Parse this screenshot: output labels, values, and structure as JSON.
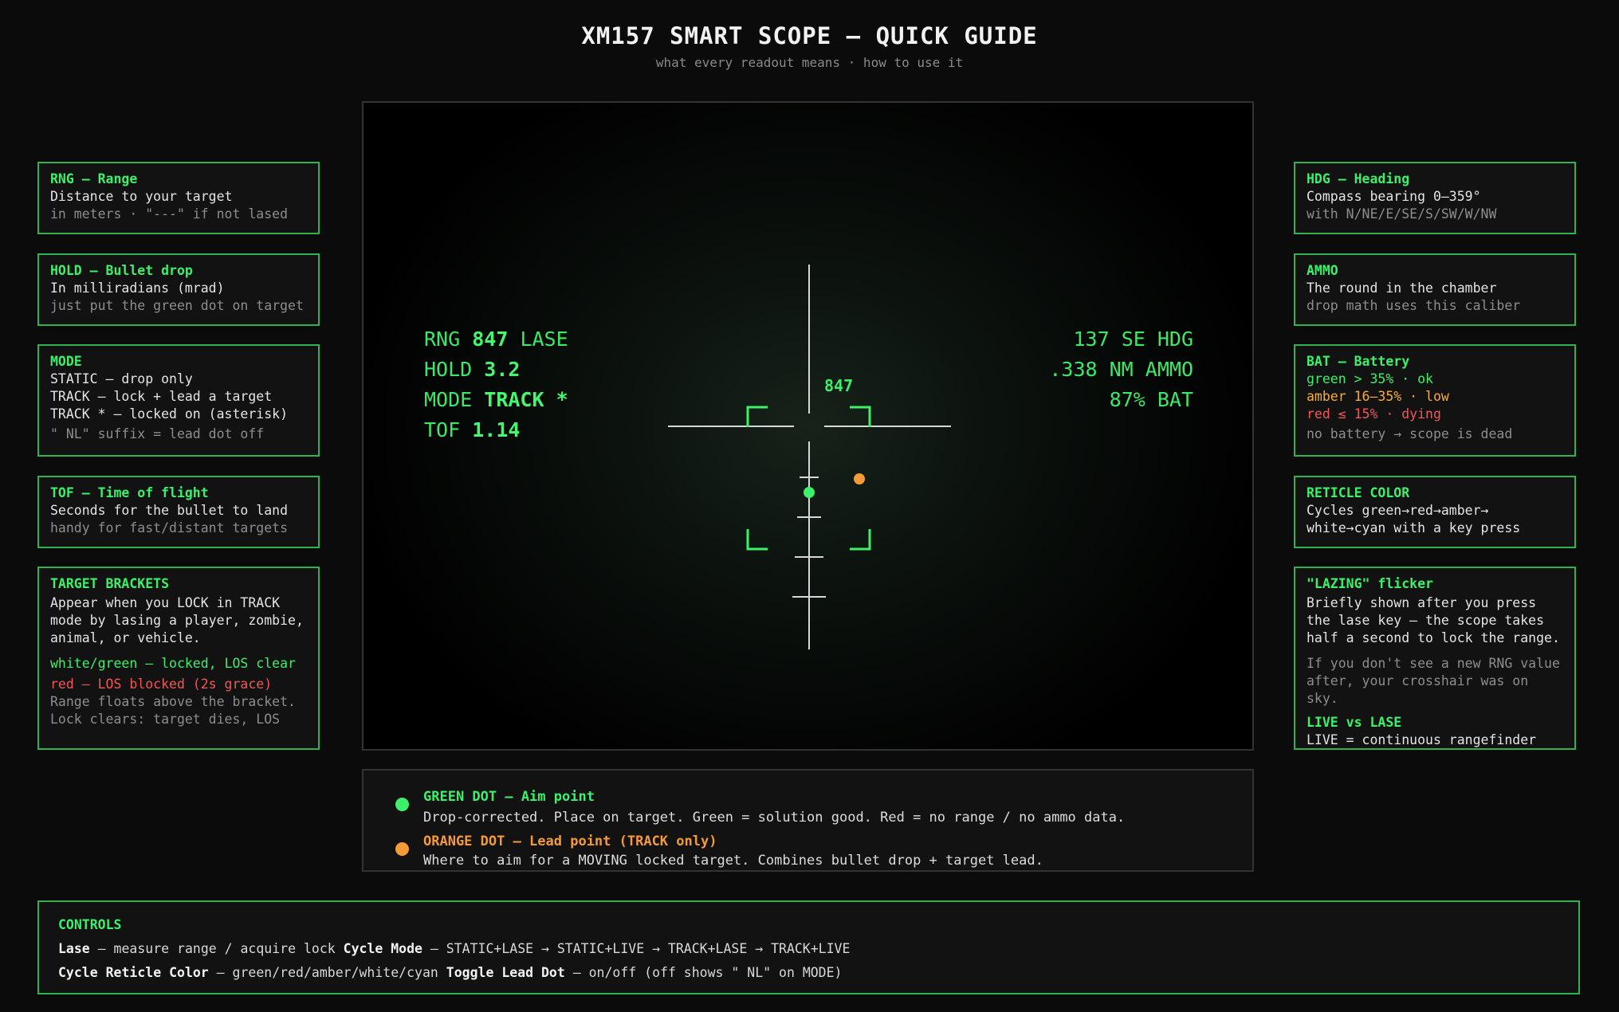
{
  "title": "XM157 SMART SCOPE — QUICK GUIDE",
  "subtitle": "what every readout means · how to use it",
  "colors": {
    "green": "#3df06a",
    "amber": "#f6ad3a",
    "red": "#f25656",
    "orange_dot": "#f59a36",
    "border": "#2fb24f"
  },
  "left_cards": {
    "rng": {
      "title": "RNG — Range",
      "line1": "Distance to your target",
      "line2": "in meters · \"---\" if not lased"
    },
    "hold": {
      "title": "HOLD — Bullet drop",
      "line1": "In milliradians (mrad)",
      "line2": "just put the green dot on target"
    },
    "mode": {
      "title": "MODE",
      "line1": "STATIC — drop only",
      "line2": "TRACK — lock + lead a target",
      "line3": "TRACK * — locked on (asterisk)",
      "line4": "\" NL\" suffix = lead dot off"
    },
    "tof": {
      "title": "TOF — Time of flight",
      "line1": "Seconds for the bullet to land",
      "line2": "handy for fast/distant targets"
    },
    "brackets": {
      "title": "TARGET BRACKETS",
      "line1": "Appear when you LOCK in TRACK",
      "line2": "mode by lasing a player, zombie,",
      "line3": "animal, or vehicle.",
      "green": "white/green — locked, LOS clear",
      "red": "red — LOS blocked (2s grace)",
      "line4": "Range floats above the bracket.",
      "line5": "Lock clears: target dies, LOS"
    }
  },
  "right_cards": {
    "hdg": {
      "title": "HDG — Heading",
      "line1": "Compass bearing 0–359°",
      "line2": "with N/NE/E/SE/S/SW/W/NW"
    },
    "ammo": {
      "title": "AMMO",
      "line1": "The round in the chamber",
      "line2": "drop math uses this caliber"
    },
    "bat": {
      "title": "BAT — Battery",
      "green": "green > 35% · ok",
      "amber": "amber 16–35% · low",
      "red": "red ≤ 15% · dying",
      "line1": "no battery → scope is dead"
    },
    "reticle": {
      "title": "RETICLE COLOR",
      "line1": "Cycles green→red→amber→",
      "line2": "white→cyan with a key press"
    },
    "lazing": {
      "title": "\"LAZING\" flicker",
      "line1": "Briefly shown after you press",
      "line2": "the lase key — the scope takes",
      "line3": "half a second to lock the range.",
      "line4": "If you don't see a new RNG value",
      "line5": "after, your crosshair was on sky.",
      "sub_title": "LIVE vs LASE",
      "line6": "LIVE = continuous rangefinder"
    }
  },
  "scope": {
    "left": {
      "rng_label": "RNG",
      "rng_value": "847",
      "rng_suffix": "LASE",
      "hold_label": "HOLD",
      "hold_value": "3.2",
      "mode_label": "MODE",
      "mode_value": "TRACK *",
      "tof_label": "TOF",
      "tof_value": "1.14"
    },
    "right": {
      "hdg": "137 SE HDG",
      "ammo": ".338 NM AMMO",
      "bat": "87% BAT"
    },
    "bracket_range": "847"
  },
  "legend": {
    "green_title": "GREEN DOT — Aim point",
    "green_desc": "Drop-corrected. Place on target. Green = solution good. Red = no range / no ammo data.",
    "orange_title": "ORANGE DOT — Lead point (TRACK only)",
    "orange_desc": "Where to aim for a MOVING locked target. Combines bullet drop + target lead."
  },
  "controls": {
    "title": "CONTROLS",
    "lase_key": "Lase",
    "lase_desc": "— measure range / acquire lock",
    "mode_key": "Cycle Mode",
    "mode_desc": "— STATIC+LASE → STATIC+LIVE → TRACK+LASE → TRACK+LIVE",
    "color_key": "Cycle Reticle Color",
    "color_desc": "— green/red/amber/white/cyan",
    "lead_key": "Toggle Lead Dot",
    "lead_desc": "— on/off (off shows \" NL\" on MODE)"
  }
}
